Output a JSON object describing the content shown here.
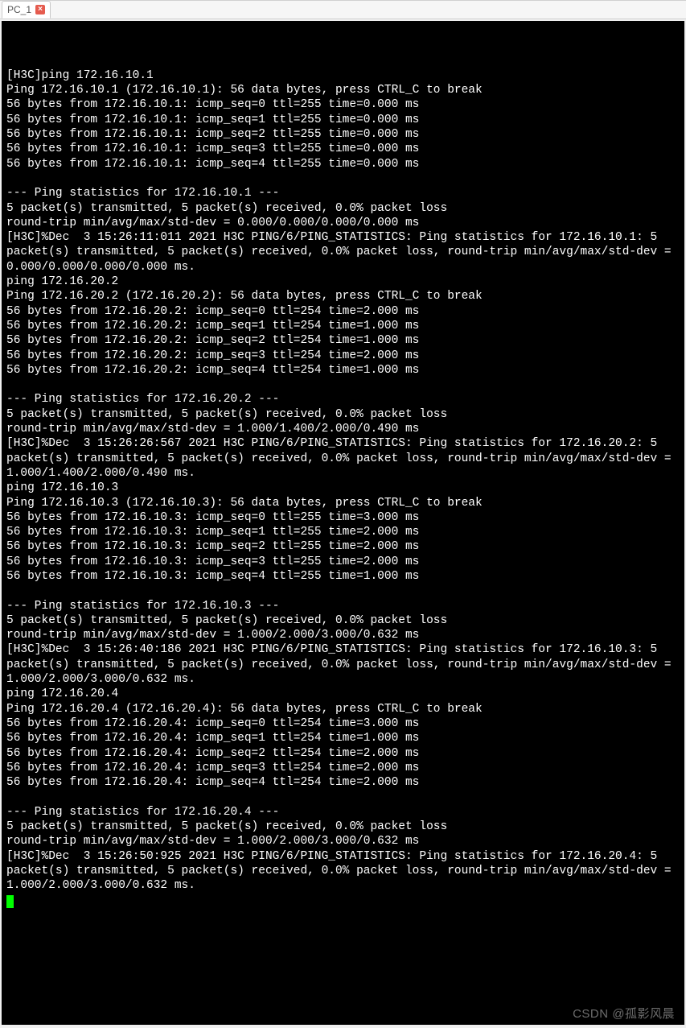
{
  "tab": {
    "label": "PC_1",
    "close_glyph": "×"
  },
  "terminal": {
    "lines": [
      "",
      "[H3C]ping 172.16.10.1",
      "Ping 172.16.10.1 (172.16.10.1): 56 data bytes, press CTRL_C to break",
      "56 bytes from 172.16.10.1: icmp_seq=0 ttl=255 time=0.000 ms",
      "56 bytes from 172.16.10.1: icmp_seq=1 ttl=255 time=0.000 ms",
      "56 bytes from 172.16.10.1: icmp_seq=2 ttl=255 time=0.000 ms",
      "56 bytes from 172.16.10.1: icmp_seq=3 ttl=255 time=0.000 ms",
      "56 bytes from 172.16.10.1: icmp_seq=4 ttl=255 time=0.000 ms",
      "",
      "--- Ping statistics for 172.16.10.1 ---",
      "5 packet(s) transmitted, 5 packet(s) received, 0.0% packet loss",
      "round-trip min/avg/max/std-dev = 0.000/0.000/0.000/0.000 ms",
      "[H3C]%Dec  3 15:26:11:011 2021 H3C PING/6/PING_STATISTICS: Ping statistics for 172.16.10.1: 5 packet(s) transmitted, 5 packet(s) received, 0.0% packet loss, round-trip min/avg/max/std-dev = 0.000/0.000/0.000/0.000 ms.",
      "ping 172.16.20.2",
      "Ping 172.16.20.2 (172.16.20.2): 56 data bytes, press CTRL_C to break",
      "56 bytes from 172.16.20.2: icmp_seq=0 ttl=254 time=2.000 ms",
      "56 bytes from 172.16.20.2: icmp_seq=1 ttl=254 time=1.000 ms",
      "56 bytes from 172.16.20.2: icmp_seq=2 ttl=254 time=1.000 ms",
      "56 bytes from 172.16.20.2: icmp_seq=3 ttl=254 time=2.000 ms",
      "56 bytes from 172.16.20.2: icmp_seq=4 ttl=254 time=1.000 ms",
      "",
      "--- Ping statistics for 172.16.20.2 ---",
      "5 packet(s) transmitted, 5 packet(s) received, 0.0% packet loss",
      "round-trip min/avg/max/std-dev = 1.000/1.400/2.000/0.490 ms",
      "[H3C]%Dec  3 15:26:26:567 2021 H3C PING/6/PING_STATISTICS: Ping statistics for 172.16.20.2: 5 packet(s) transmitted, 5 packet(s) received, 0.0% packet loss, round-trip min/avg/max/std-dev = 1.000/1.400/2.000/0.490 ms.",
      "ping 172.16.10.3",
      "Ping 172.16.10.3 (172.16.10.3): 56 data bytes, press CTRL_C to break",
      "56 bytes from 172.16.10.3: icmp_seq=0 ttl=255 time=3.000 ms",
      "56 bytes from 172.16.10.3: icmp_seq=1 ttl=255 time=2.000 ms",
      "56 bytes from 172.16.10.3: icmp_seq=2 ttl=255 time=2.000 ms",
      "56 bytes from 172.16.10.3: icmp_seq=3 ttl=255 time=2.000 ms",
      "56 bytes from 172.16.10.3: icmp_seq=4 ttl=255 time=1.000 ms",
      "",
      "--- Ping statistics for 172.16.10.3 ---",
      "5 packet(s) transmitted, 5 packet(s) received, 0.0% packet loss",
      "round-trip min/avg/max/std-dev = 1.000/2.000/3.000/0.632 ms",
      "[H3C]%Dec  3 15:26:40:186 2021 H3C PING/6/PING_STATISTICS: Ping statistics for 172.16.10.3: 5 packet(s) transmitted, 5 packet(s) received, 0.0% packet loss, round-trip min/avg/max/std-dev = 1.000/2.000/3.000/0.632 ms.",
      "ping 172.16.20.4",
      "Ping 172.16.20.4 (172.16.20.4): 56 data bytes, press CTRL_C to break",
      "56 bytes from 172.16.20.4: icmp_seq=0 ttl=254 time=3.000 ms",
      "56 bytes from 172.16.20.4: icmp_seq=1 ttl=254 time=1.000 ms",
      "56 bytes from 172.16.20.4: icmp_seq=2 ttl=254 time=2.000 ms",
      "56 bytes from 172.16.20.4: icmp_seq=3 ttl=254 time=2.000 ms",
      "56 bytes from 172.16.20.4: icmp_seq=4 ttl=254 time=2.000 ms",
      "",
      "--- Ping statistics for 172.16.20.4 ---",
      "5 packet(s) transmitted, 5 packet(s) received, 0.0% packet loss",
      "round-trip min/avg/max/std-dev = 1.000/2.000/3.000/0.632 ms",
      "[H3C]%Dec  3 15:26:50:925 2021 H3C PING/6/PING_STATISTICS: Ping statistics for 172.16.20.4: 5 packet(s) transmitted, 5 packet(s) received, 0.0% packet loss, round-trip min/avg/max/std-dev = 1.000/2.000/3.000/0.632 ms."
    ]
  },
  "watermark": "CSDN @孤影风晨"
}
